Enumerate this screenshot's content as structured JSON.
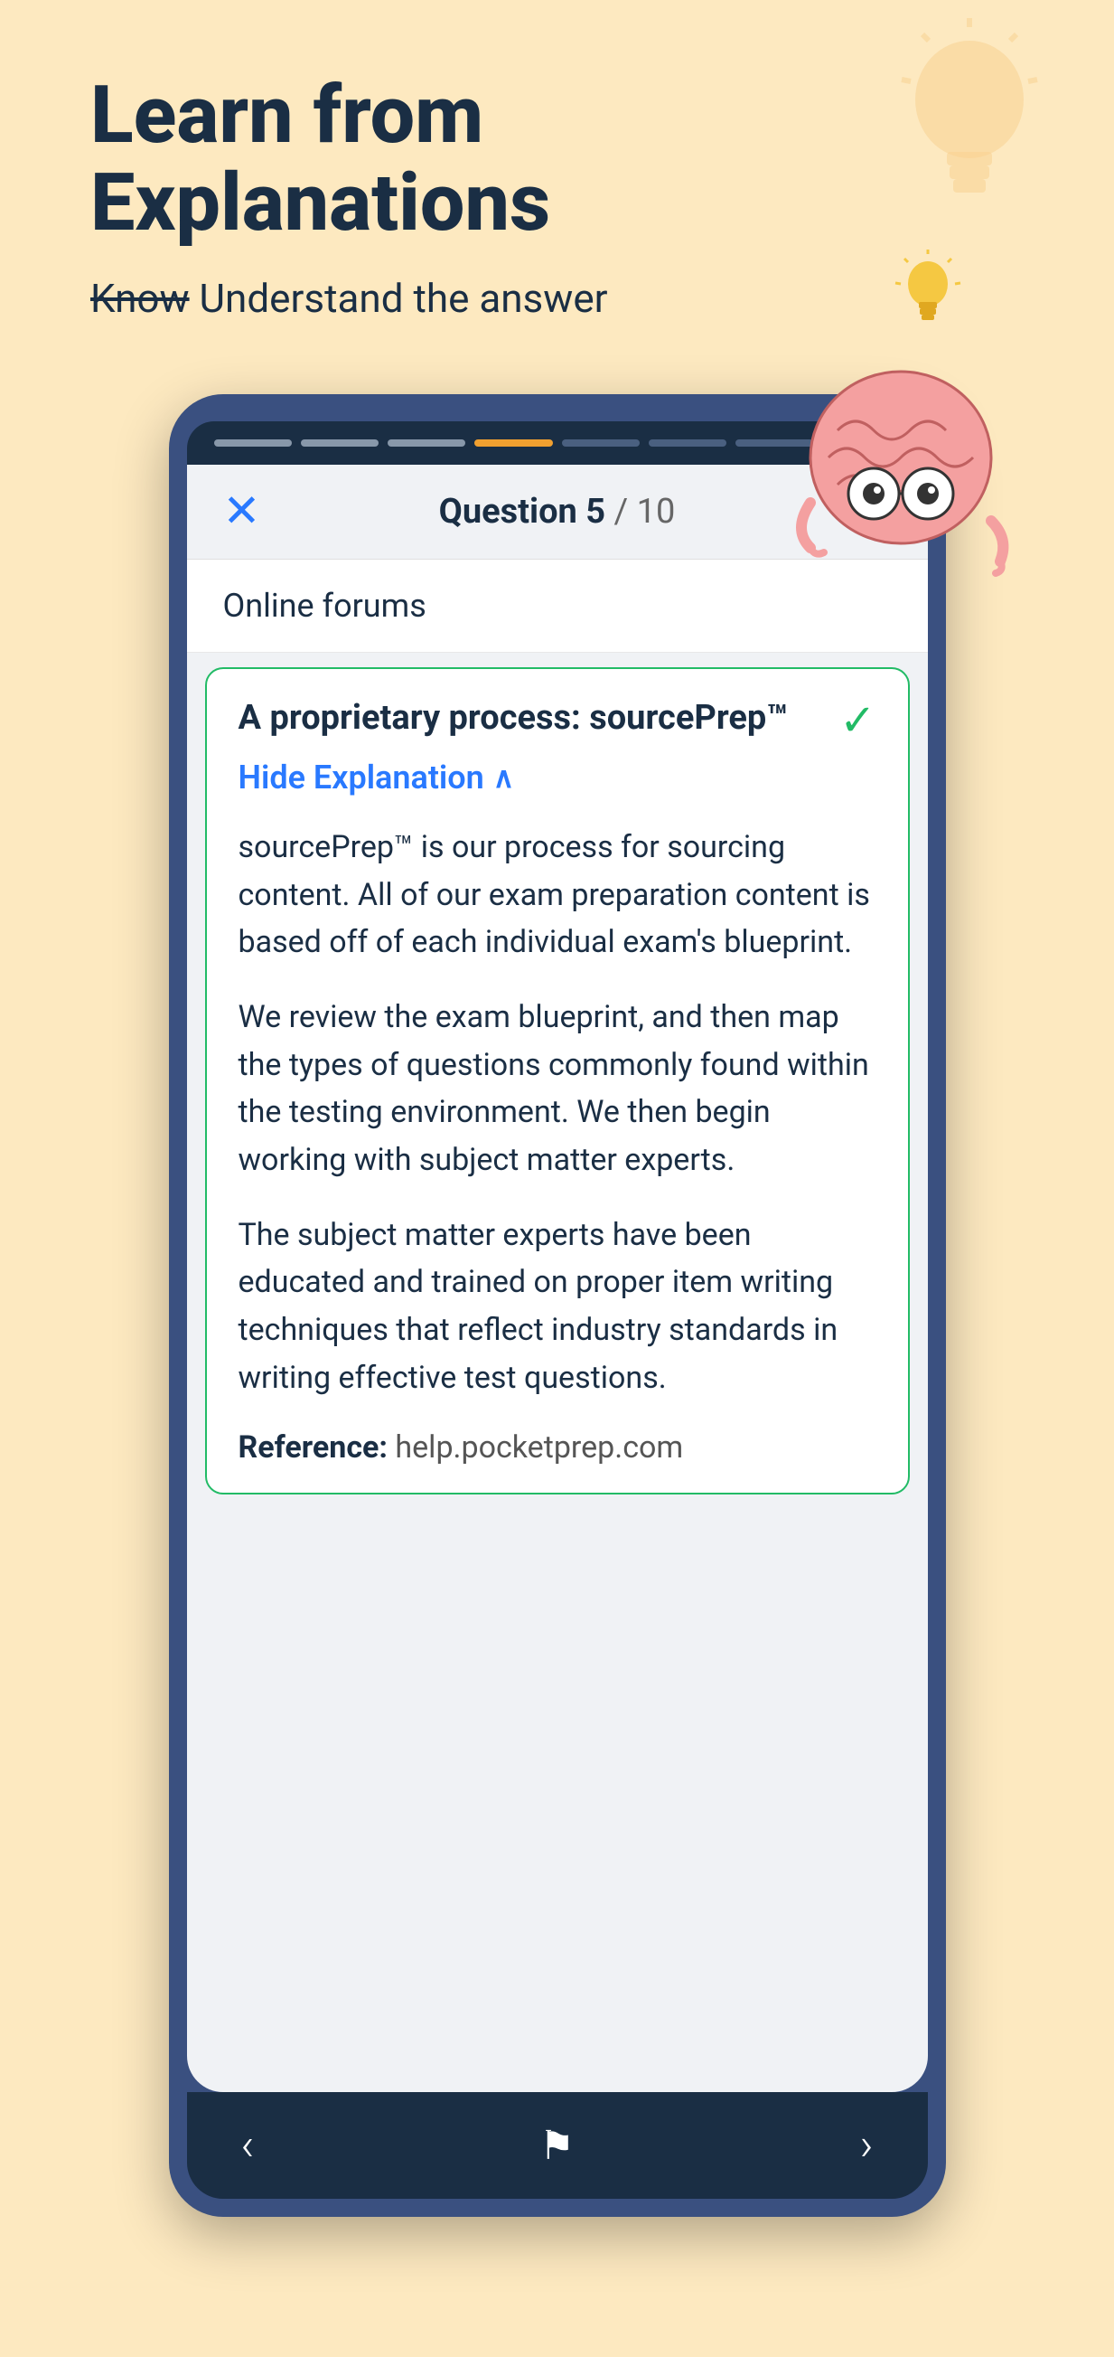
{
  "header": {
    "title_line1": "Learn from",
    "title_line2": "Explanations",
    "subtitle_strikethrough": "Know",
    "subtitle_rest": " Understand the answer"
  },
  "phone": {
    "progress_bars": [
      {
        "state": "completed"
      },
      {
        "state": "completed"
      },
      {
        "state": "completed"
      },
      {
        "state": "active"
      },
      {
        "state": "default"
      },
      {
        "state": "default"
      },
      {
        "state": "default"
      },
      {
        "state": "default"
      }
    ],
    "question_label": "Question 5",
    "question_separator": " / 10",
    "option_text": "Online forums",
    "answer": {
      "title": "A proprietary process: sourcePrep™",
      "hide_explanation_label": "Hide Explanation",
      "explanation_paragraphs": [
        "sourcePrep™ is our process for sourcing content. All of our exam preparation content is based off of each individual exam's blueprint.",
        "We review the exam blueprint, and then map the types of questions commonly found within the testing environment. We then begin working with subject matter experts.",
        "The subject matter experts have been educated and trained on proper item writing techniques that reflect industry standards in writing effective test questions."
      ],
      "reference_label": "Reference:",
      "reference_url": "  help.pocketprep.com"
    },
    "bottom_nav": {
      "back_label": "‹",
      "flag_label": "⚑",
      "forward_label": "›"
    }
  }
}
